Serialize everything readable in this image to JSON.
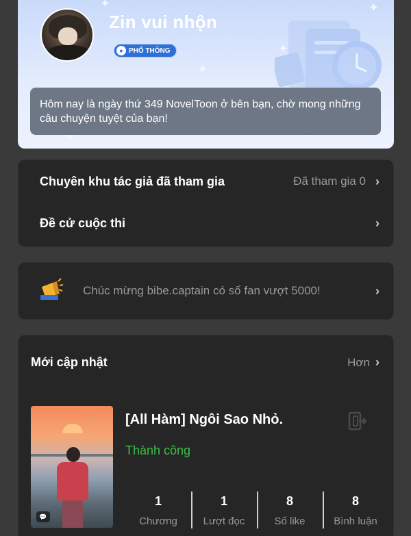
{
  "profile": {
    "username": "Zin vui nhộn",
    "badge": "PHỔ THÔNG",
    "message": "Hôm nay là ngày thứ 349 NovelToon ở bên bạn, chờ mong những câu chuyện tuyệt của bạn!"
  },
  "menu": {
    "items": [
      {
        "label": "Chuyên khu tác giả đã tham gia",
        "value": "Đã tham gia 0"
      },
      {
        "label": "Đề cử cuộc thi",
        "value": ""
      }
    ]
  },
  "notice": {
    "text": "Chúc mừng bibe.captain có số fan vượt 5000!",
    "icon": "megaphone-icon"
  },
  "updates": {
    "title": "Mới cập nhật",
    "more_label": "Hơn",
    "book": {
      "title": "[All Hàm] Ngôi Sao Nhỏ.",
      "status": "Thành công",
      "stats": [
        {
          "value": "1",
          "label": "Chương"
        },
        {
          "value": "1",
          "label": "Lượt đọc"
        },
        {
          "value": "8",
          "label": "Số like"
        },
        {
          "value": "8",
          "label": "Bình luận"
        }
      ]
    }
  },
  "colors": {
    "status_green": "#3bbf4a",
    "badge_blue": "#2f6fd6",
    "card_bg": "#262626"
  }
}
